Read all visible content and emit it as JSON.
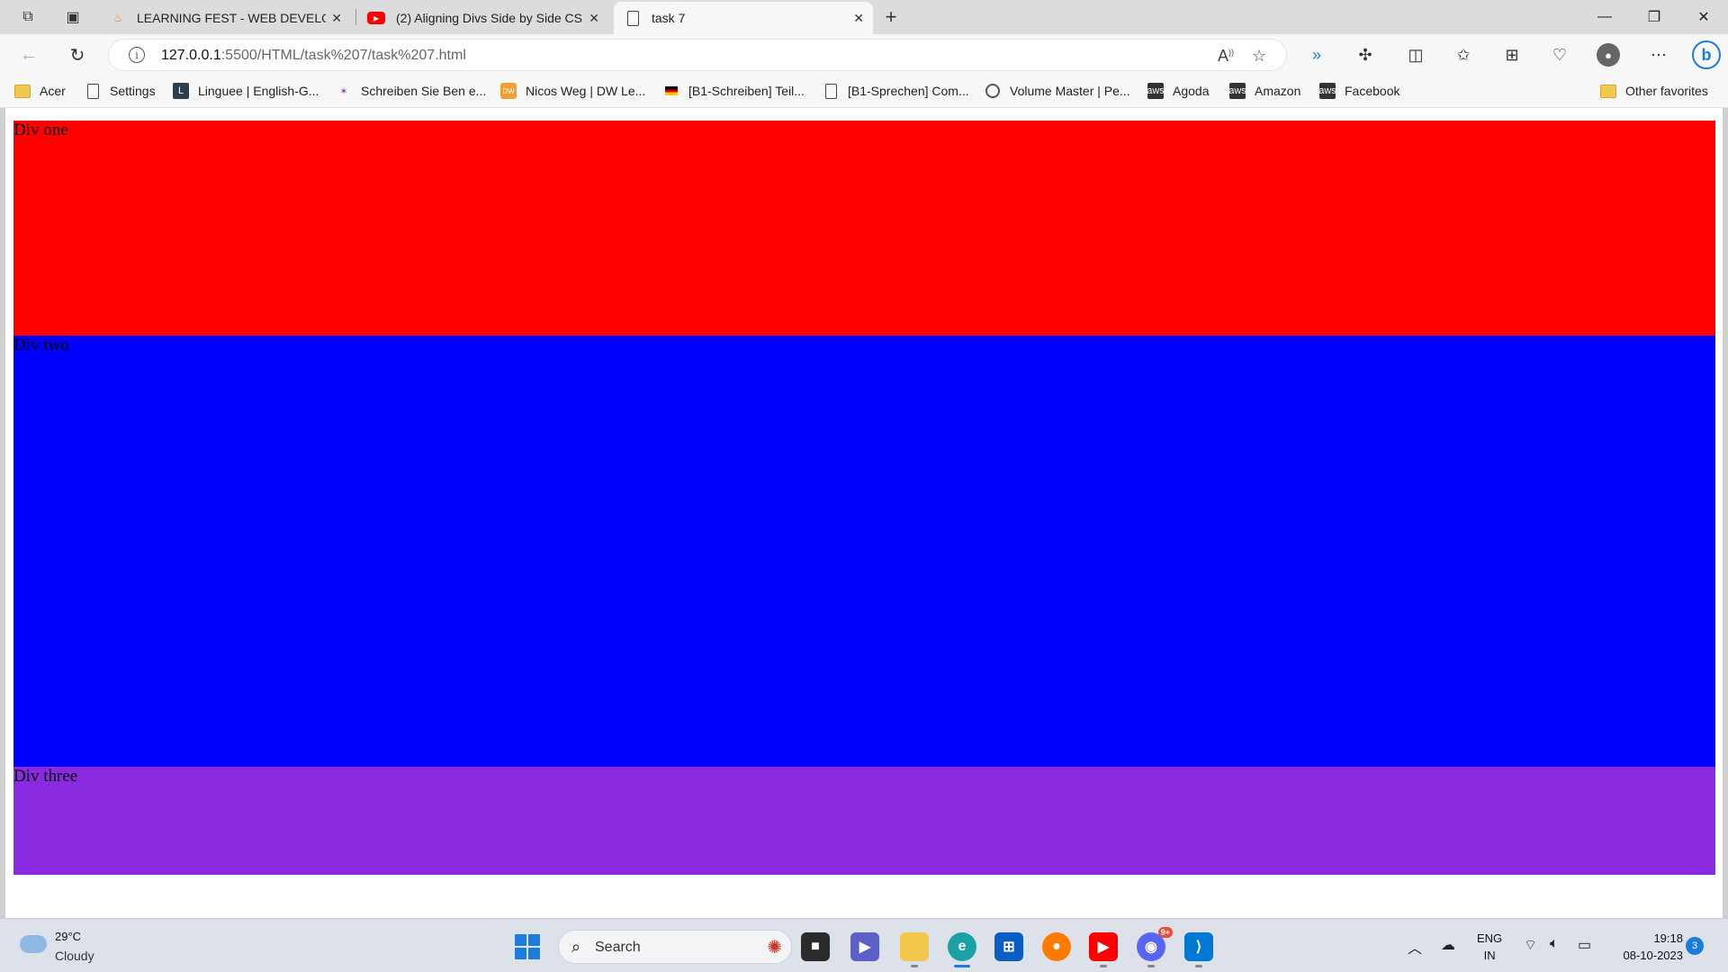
{
  "browser": {
    "tabs": [
      {
        "title": "LEARNING FEST - WEB DEVELOP",
        "active": false
      },
      {
        "title": "(2) Aligning Divs Side by Side CS",
        "active": false
      },
      {
        "title": "task 7",
        "active": true
      }
    ],
    "new_tab_label": "+",
    "window_controls": {
      "minimize": "—",
      "restore": "❐",
      "close": "✕"
    },
    "url": {
      "host": "127.0.0.1",
      "path": ":5500/HTML/task%207/task%207.html"
    },
    "bookmarks": [
      {
        "label": "Acer",
        "icon": "folder-icon"
      },
      {
        "label": "Settings",
        "icon": "page-icon"
      },
      {
        "label": "Linguee | English-G...",
        "icon": "linguee-icon"
      },
      {
        "label": "Schreiben Sie Ben e...",
        "icon": "bird-icon"
      },
      {
        "label": "Nicos Weg | DW Le...",
        "icon": "dw-icon"
      },
      {
        "label": "[B1-Schreiben] Teil...",
        "icon": "flag-de-icon"
      },
      {
        "label": "[B1-Sprechen] Com...",
        "icon": "page-icon"
      },
      {
        "label": "Volume Master | Pe...",
        "icon": "circle-icon"
      },
      {
        "label": "Agoda",
        "icon": "aws-icon"
      },
      {
        "label": "Amazon",
        "icon": "aws-icon"
      },
      {
        "label": "Facebook",
        "icon": "aws-icon"
      }
    ],
    "other_favorites": "Other favorites"
  },
  "page": {
    "div_one": "Div one",
    "div_two": "Div two",
    "div_three": "Div three",
    "colors": {
      "div_one": "#ff0000",
      "div_two": "#0000ff",
      "div_three": "#8a2be2"
    }
  },
  "taskbar": {
    "weather_temp": "29°C",
    "weather_desc": "Cloudy",
    "search_label": "Search",
    "lang_line1": "ENG",
    "lang_line2": "IN",
    "time": "19:18",
    "date": "08-10-2023",
    "notification_count": "3",
    "discord_badge": "9+"
  }
}
